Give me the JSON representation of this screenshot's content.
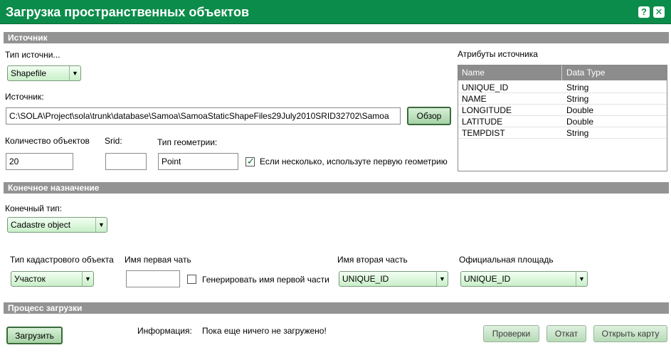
{
  "window": {
    "title": "Загрузка пространственных объектов",
    "help_icon": "?",
    "close_icon": "✕"
  },
  "source_section": {
    "header": "Источник",
    "source_type_label": "Тип источни...",
    "source_type_value": "Shapefile",
    "source_label": "Источник:",
    "source_path": "C:\\SOLA\\Project\\sola\\trunk\\database\\Samoa\\SamoaStaticShapeFiles29July2010SRID32702\\Samoa",
    "browse_button": "Обзор",
    "count_label": "Количество объектов",
    "count_value": "20",
    "srid_label": "Srid:",
    "srid_value": "",
    "geometry_label": "Тип геометрии:",
    "geometry_value": "Point",
    "first_geometry_checkbox_label": "Если несколько, используте первую геометрию",
    "first_geometry_checked": true,
    "attributes_label": "Атрибуты источника",
    "attributes_columns": [
      "Name",
      "Data Type"
    ],
    "attributes_rows": [
      {
        "name": "UNIQUE_ID",
        "type": "String"
      },
      {
        "name": "NAME",
        "type": "String"
      },
      {
        "name": "LONGITUDE",
        "type": "Double"
      },
      {
        "name": "LATITUDE",
        "type": "Double"
      },
      {
        "name": "TEMPDIST",
        "type": "String"
      }
    ]
  },
  "target_section": {
    "header": "Конечное назначение",
    "target_type_label": "Конечный тип:",
    "target_type_value": "Cadastre object",
    "cadastre_type_label": "Тип кадастрового объекта",
    "cadastre_type_value": "Участок",
    "first_part_label": "Имя первая чать",
    "first_part_value": "",
    "generate_first_part_label": "Генерировать имя первой части",
    "generate_first_part_checked": false,
    "second_part_label": "Имя вторая часть",
    "second_part_value": "UNIQUE_ID",
    "official_area_label": "Официальная площадь",
    "official_area_value": "UNIQUE_ID"
  },
  "process_section": {
    "header": "Процесс загрузки",
    "load_button": "Загрузить",
    "info_label": "Информация:",
    "info_text": "Пока еще ничего не загружено!",
    "check_button": "Проверки",
    "rollback_button": "Откат",
    "open_map_button": "Открыть карту"
  },
  "colors": {
    "titlebar": "#0c8c4a",
    "section_header": "#939393",
    "button_green": "#a6d2a6"
  }
}
